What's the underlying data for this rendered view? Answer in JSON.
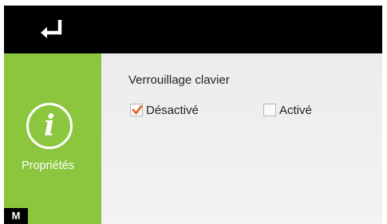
{
  "header": {
    "back_icon": "return-arrow-icon"
  },
  "sidebar": {
    "icon": "info-icon",
    "icon_glyph": "i",
    "label": "Propriétés",
    "mode_badge": "M"
  },
  "main": {
    "setting_title": "Verrouillage clavier",
    "options": [
      {
        "label": "Désactivé",
        "checked": true
      },
      {
        "label": "Activé",
        "checked": false
      }
    ]
  },
  "colors": {
    "sidebar": "#8cc63f",
    "topbar": "#000000",
    "check": "#e06a2c"
  }
}
